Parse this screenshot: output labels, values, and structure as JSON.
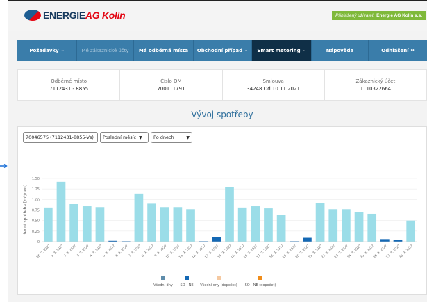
{
  "brand": {
    "name_main": "ENERGIE",
    "name_accent": "AG Kolín"
  },
  "user": {
    "label": "Přihlášený uživatel:",
    "name": "Energie AG Kolín a.s."
  },
  "nav": [
    {
      "label": "Požadavky",
      "chev": "⌄"
    },
    {
      "label": "Mé zákaznické účty",
      "chev": ""
    },
    {
      "label": "Má odběrná místa",
      "chev": ""
    },
    {
      "label": "Obchodní případ",
      "chev": "⌄"
    },
    {
      "label": "Smart metering",
      "chev": "⌄"
    },
    {
      "label": "Nápověda",
      "chev": ""
    },
    {
      "label": "Odhlášení",
      "chev": "↦"
    }
  ],
  "info": [
    {
      "label": "Odběrné místo",
      "value": "7112431 - 8855"
    },
    {
      "label": "Číslo OM",
      "value": "700111791"
    },
    {
      "label": "Smlouva",
      "value": "34248 Od 10.11.2021"
    },
    {
      "label": "Zákaznický účet",
      "value": "1110322664"
    }
  ],
  "page_title": "Vývoj spotřeby",
  "controls": {
    "meter": "70046575 (7112431-8855-Vs)",
    "period": "Poslední měsíc",
    "granularity": "Po dnech"
  },
  "chart_data": {
    "type": "bar",
    "ylabel": "denní spotřeba [m³/den]",
    "ylim": [
      0,
      1.5
    ],
    "yticks": [
      "1.50",
      "1.25",
      "1.00",
      "0.75",
      "0.50",
      "0.25",
      "0"
    ],
    "categories": [
      "28. 2. 2022",
      "1. 3. 2022",
      "2. 3. 2022",
      "3. 3. 2022",
      "4. 3. 2022",
      "5. 3. 2022",
      "6. 3. 2022",
      "7. 3. 2022",
      "8. 3. 2022",
      "9. 3. 2022",
      "10. 3. 2022",
      "11. 3. 2022",
      "12. 3. 2022",
      "13. 3. 2022",
      "14. 3. 2022",
      "15. 3. 2022",
      "16. 3. 2022",
      "17. 3. 2022",
      "18. 3. 2022",
      "19. 3. 2022",
      "20. 3. 2022",
      "21. 3. 2022",
      "22. 3. 2022",
      "23. 3. 2022",
      "24. 3. 2022",
      "25. 3. 2022",
      "26. 3. 2022",
      "27. 3. 2022",
      "28. 3. 2022"
    ],
    "values": [
      0.81,
      1.42,
      0.89,
      0.84,
      0.82,
      0.02,
      0.01,
      1.14,
      0.9,
      0.82,
      0.82,
      0.77,
      0.01,
      0.11,
      1.29,
      0.81,
      0.84,
      0.79,
      0.64,
      0.01,
      0.09,
      0.91,
      0.77,
      0.77,
      0.7,
      0.66,
      0.06,
      0.04,
      0.5
    ],
    "kinds": [
      "wd",
      "wd",
      "wd",
      "wd",
      "wd",
      "we",
      "we",
      "wd",
      "wd",
      "wd",
      "wd",
      "wd",
      "we",
      "we",
      "wd",
      "wd",
      "wd",
      "wd",
      "wd",
      "we",
      "we",
      "wd",
      "wd",
      "wd",
      "wd",
      "wd",
      "we",
      "we",
      "wd"
    ],
    "legend": [
      {
        "name": "Všední dny",
        "color": "#5f8dab"
      },
      {
        "name": "SO - NE",
        "color": "#1468b4"
      },
      {
        "name": "Všední dny (dopočet)",
        "color": "#f5c9a1"
      },
      {
        "name": "SO - NE (dopočet)",
        "color": "#f08c1a"
      }
    ],
    "colors": {
      "wd": "#9bdde8",
      "we": "#1468b4"
    }
  }
}
